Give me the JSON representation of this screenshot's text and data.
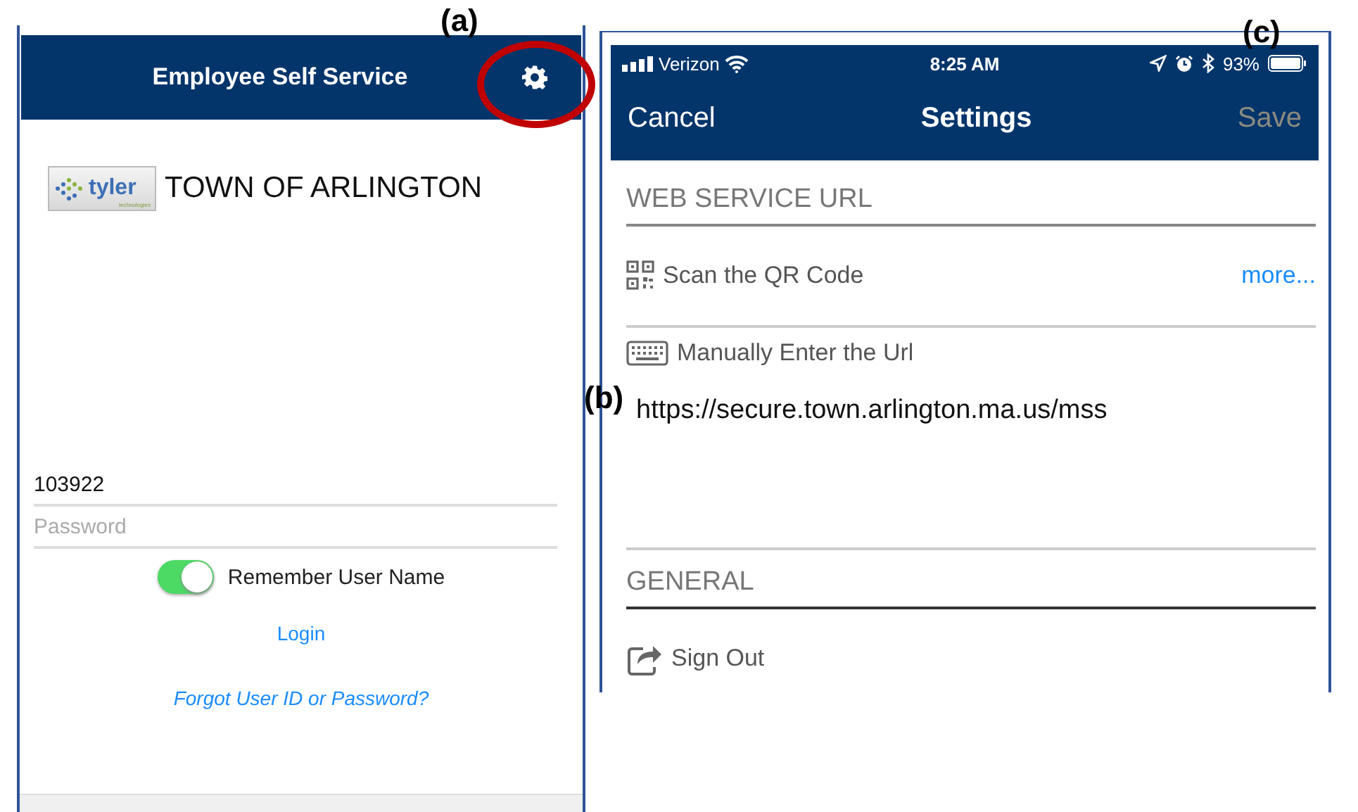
{
  "panel_labels": [
    "(a)",
    "(c)",
    "(b)"
  ],
  "login_screen": {
    "title": "Employee Self Service",
    "settings_highlighted": true,
    "logo": {
      "brand": "tyler",
      "subtext": "technologies"
    },
    "org_name": "TOWN OF ARLINGTON",
    "username": {
      "value": "103922"
    },
    "password": {
      "placeholder": "Password"
    },
    "remember": {
      "label": "Remember User Name",
      "on": true
    },
    "login_link": "Login",
    "forgot_link": "Forgot User ID or Password?"
  },
  "settings_screen": {
    "status_bar": {
      "carrier": "Verizon",
      "time": "8:25 AM",
      "battery": "93%"
    },
    "nav": {
      "cancel": "Cancel",
      "title": "Settings",
      "save": {
        "label": "Save",
        "disabled": true
      }
    },
    "sections": [
      {
        "header": "WEB SERVICE URL",
        "items": [
          {
            "kind": "qr",
            "label": "Scan the QR Code",
            "action": "more..."
          },
          {
            "kind": "manual",
            "label": "Manually Enter the Url",
            "value": "https://secure.town.arlington.ma.us/mss"
          }
        ]
      },
      {
        "header": "GENERAL",
        "items": [
          {
            "kind": "signout",
            "label": "Sign Out"
          }
        ]
      }
    ]
  }
}
